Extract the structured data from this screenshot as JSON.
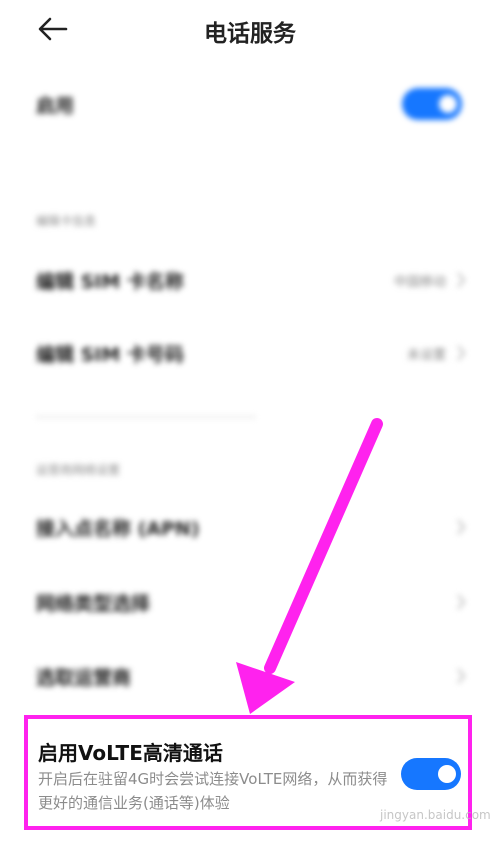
{
  "header": {
    "title": "电话服务"
  },
  "settings": {
    "enable_label": "启用",
    "section1_label": "编辑卡信息",
    "sim_name_label": "编辑 SIM 卡名称",
    "sim_name_value": "中国移动",
    "sim_number_label": "编辑 SIM 卡号码",
    "sim_number_value": "未设置",
    "section2_label": "运营商网络设置",
    "apn_label": "接入点名称 (APN)",
    "network_type_label": "网络类型选择",
    "carrier_label": "选取运营商"
  },
  "volte": {
    "title": "启用VoLTE高清通话",
    "description": "开启后在驻留4G时会尝试连接VoLTE网络，从而获得更好的通信业务(通话等)体验",
    "enabled": true
  },
  "watermark": "jingyan.baidu.com",
  "colors": {
    "toggle_on": "#1677ff",
    "highlight": "#ff22ee"
  }
}
